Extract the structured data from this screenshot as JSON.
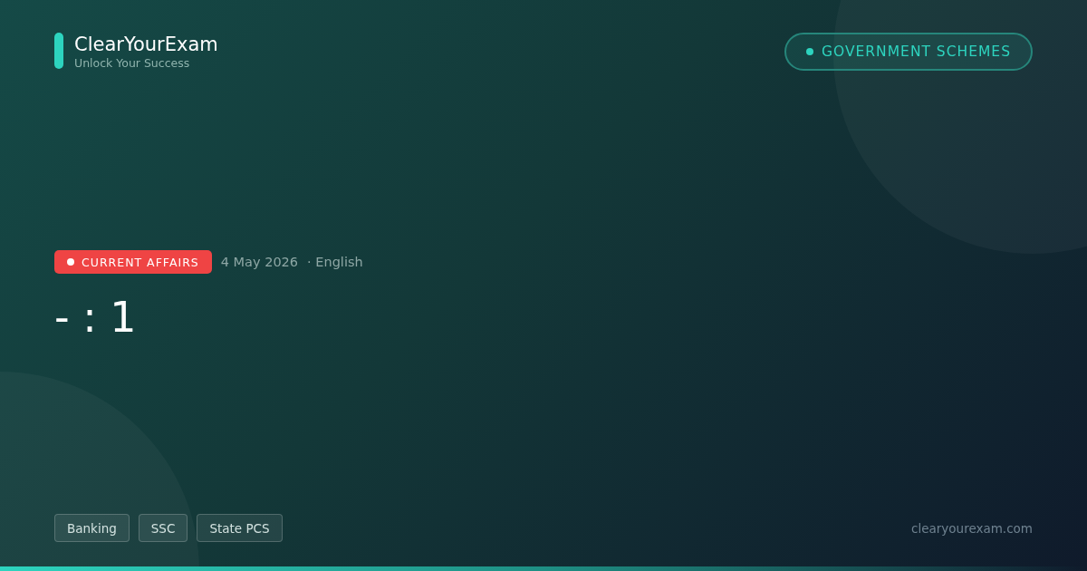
{
  "brand": {
    "name": "ClearYourExam",
    "tagline": "Unlock Your Success"
  },
  "category_pill": {
    "label": "GOVERNMENT SCHEMES"
  },
  "meta": {
    "badge": "CURRENT AFFAIRS",
    "date": "4 May 2026",
    "language": "· English"
  },
  "title": "- : 1",
  "tags": [
    "Banking",
    "SSC",
    "State PCS"
  ],
  "site": "clearyourexam.com"
}
